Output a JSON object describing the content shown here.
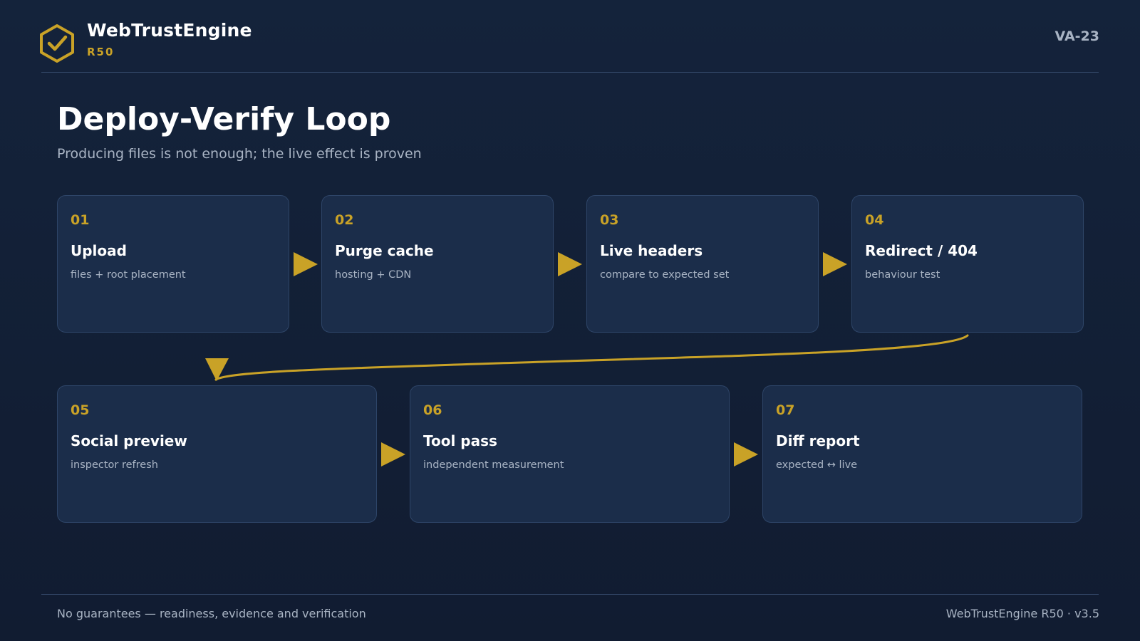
{
  "header": {
    "brand_name": "WebTrustEngine",
    "brand_sub": "R50",
    "doc_code": "VA-23",
    "logo_icon": "hexagon-check-icon"
  },
  "main": {
    "title": "Deploy-Verify Loop",
    "subtitle": "Producing files is not enough; the live effect is proven"
  },
  "steps": [
    {
      "num": "01",
      "title": "Upload",
      "desc": "files + root placement"
    },
    {
      "num": "02",
      "title": "Purge cache",
      "desc": "hosting + CDN"
    },
    {
      "num": "03",
      "title": "Live headers",
      "desc": "compare to expected set"
    },
    {
      "num": "04",
      "title": "Redirect / 404",
      "desc": "behaviour test"
    },
    {
      "num": "05",
      "title": "Social preview",
      "desc": "inspector refresh"
    },
    {
      "num": "06",
      "title": "Tool pass",
      "desc": "independent measurement"
    },
    {
      "num": "07",
      "title": "Diff report",
      "desc": "expected ↔ live"
    }
  ],
  "footer": {
    "left": "No guarantees — readiness, evidence and verification",
    "right": "WebTrustEngine R50 · v3.5"
  },
  "colors": {
    "background": "#13213a",
    "card": "#1b2d4a",
    "card_border": "#2e4568",
    "accent": "#c9a227",
    "text": "#ffffff",
    "muted": "#a9b4c4"
  }
}
